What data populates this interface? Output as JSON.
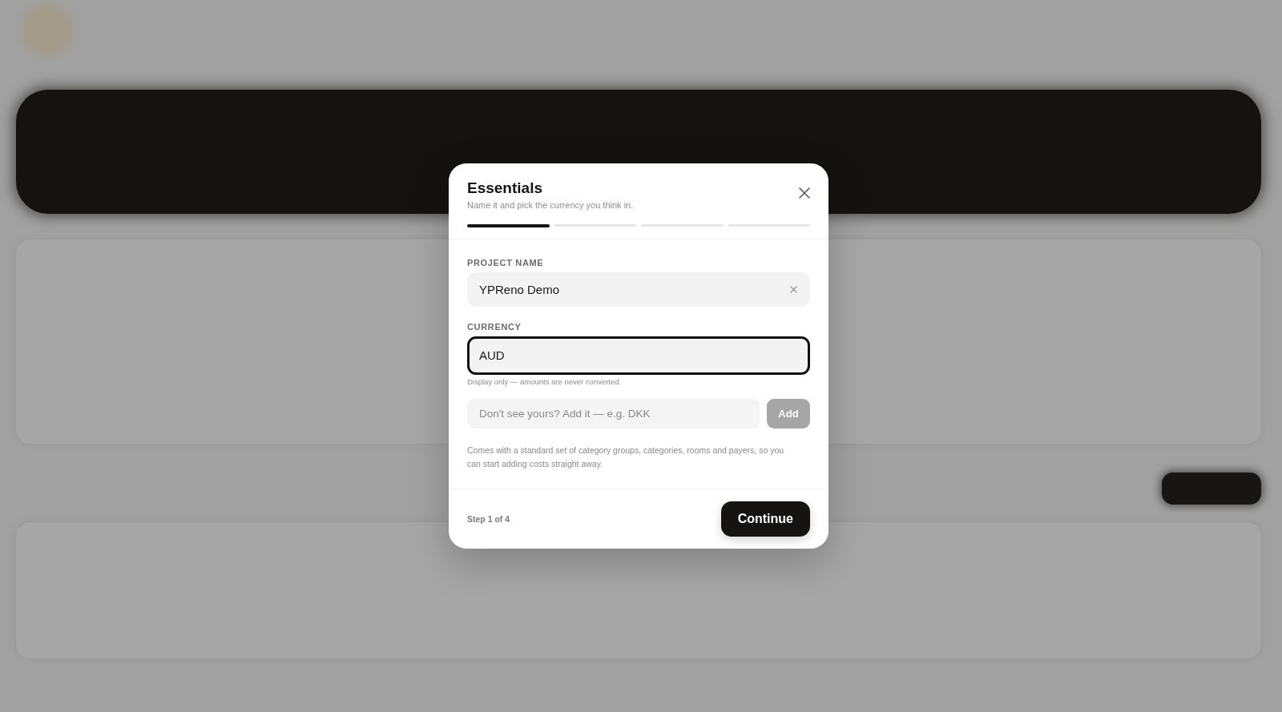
{
  "dialog": {
    "title": "Essentials",
    "subtitle": "Name it and pick the currency you think in.",
    "steps": [
      {
        "selected": true
      },
      {
        "selected": false
      },
      {
        "selected": false
      },
      {
        "selected": false
      }
    ],
    "fields": [
      {
        "label": "PROJECT NAME",
        "value": "YPReno Demo",
        "clearable": true,
        "focused": false
      },
      {
        "label": "CURRENCY",
        "value": "AUD",
        "clearable": false,
        "focused": true,
        "hint": "Display only — amounts are never converted."
      }
    ],
    "add_currency": {
      "placeholder": "Don't see yours? Add it — e.g. DKK",
      "button": {
        "label": "Add",
        "disabled": true
      }
    },
    "note": "Comes with a standard set of category groups, categories, rooms and payers, so you can start adding costs straight away.",
    "footer": {
      "step": "Step 1 of 4",
      "primary_button": "Continue"
    }
  }
}
